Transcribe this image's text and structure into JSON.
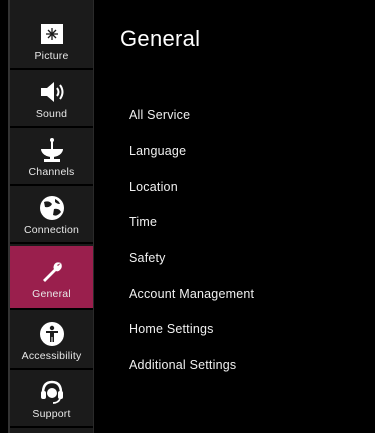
{
  "page": {
    "title": "General"
  },
  "sidebar": {
    "items": [
      {
        "label": "Picture",
        "icon": "picture-icon"
      },
      {
        "label": "Sound",
        "icon": "speaker-icon"
      },
      {
        "label": "Channels",
        "icon": "satellite-dish-icon"
      },
      {
        "label": "Connection",
        "icon": "globe-icon"
      },
      {
        "label": "General",
        "icon": "wrench-icon",
        "active": true
      },
      {
        "label": "Accessibility",
        "icon": "accessibility-icon"
      },
      {
        "label": "Support",
        "icon": "headset-icon"
      }
    ]
  },
  "menu": {
    "items": [
      "All Service",
      "Language",
      "Location",
      "Time",
      "Safety",
      "Account Management",
      "Home Settings",
      "Additional Settings"
    ]
  },
  "colors": {
    "active": "#9a1f4d",
    "sidebar_bg": "#1b1b1b",
    "background": "#000000"
  }
}
